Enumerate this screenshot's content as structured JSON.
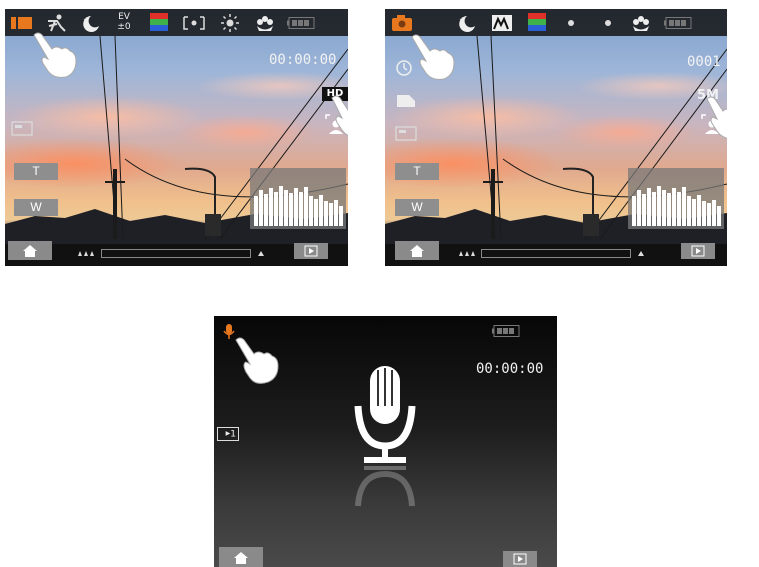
{
  "screen_video": {
    "timer": "00:00:00",
    "resolution_badge": "HD",
    "zoom_tele_label": "T",
    "zoom_wide_label": "W",
    "top_icons": [
      "video-mode-icon",
      "scene-sport-icon",
      "night-mode-icon",
      "ev-icon",
      "color-mode-icon",
      "metering-icon",
      "white-balance-icon",
      "macro-icon",
      "battery-icon"
    ],
    "ev_label_top": "EV",
    "ev_label_bottom": "±0"
  },
  "screen_photo": {
    "shot_counter": "0001",
    "resolution_badge": "5M",
    "zoom_tele_label": "T",
    "zoom_wide_label": "W",
    "top_icons": [
      "camera-mode-icon",
      "night-mode-icon",
      "scene-icon",
      "color-mode-icon",
      "dot-icon",
      "dot-icon",
      "macro-icon",
      "battery-icon"
    ]
  },
  "screen_audio": {
    "timer": "00:00:00",
    "media_badge": "1",
    "top_icons": [
      "audio-mode-icon",
      "battery-icon"
    ]
  },
  "colors": {
    "accent_orange": "#e8781e",
    "button_gray": "#8e8e8e",
    "bar_dark": "#141414"
  }
}
